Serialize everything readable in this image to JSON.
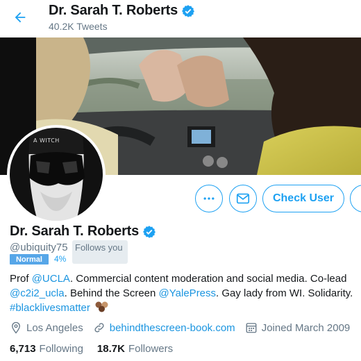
{
  "header": {
    "name": "Dr. Sarah T. Roberts",
    "tweets_count": "40.2K Tweets"
  },
  "profile": {
    "name": "Dr. Sarah T. Roberts",
    "handle": "@ubiquity75",
    "follows_you": "Follows you",
    "tag_label": "Normal",
    "tag_percent": "4%",
    "avatar_text": "A WITCH",
    "check_user_label": "Check User"
  },
  "bio": {
    "p1": "Prof ",
    "ucla": "@UCLA",
    "p2": ". Commercial content moderation and social media. Co-lead",
    "c2i2": "@c2i2_ucla",
    "p3": ". Behind the Screen ",
    "yale": "@YalePress",
    "p4": ". Gay lady from WI. Solidarity.",
    "hashtag": "#blacklivesmatter"
  },
  "meta": {
    "location": "Los Angeles",
    "website": "behindthescreen-book.com",
    "joined": "Joined March 2009"
  },
  "stats": {
    "following_count": "6,713",
    "following_label": "Following",
    "followers_count": "18.7K",
    "followers_label": "Followers"
  },
  "colors": {
    "accent": "#1da1f2",
    "tag_bg": "#56a6e8",
    "muted": "#657786"
  },
  "icons": [
    "back-arrow-icon",
    "verified-badge-icon",
    "more-icon",
    "message-icon",
    "location-icon",
    "link-icon",
    "calendar-icon"
  ]
}
